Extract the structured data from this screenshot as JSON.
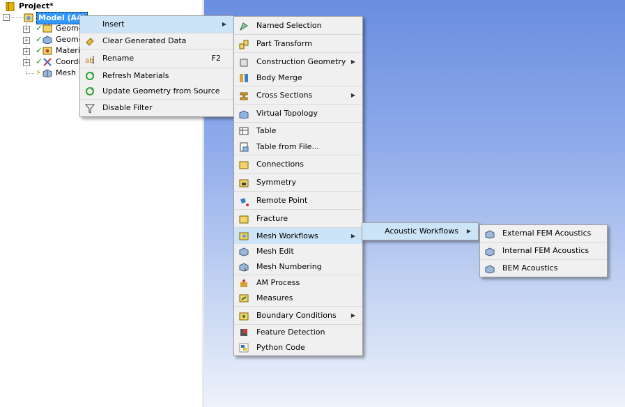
{
  "tree": {
    "project_label": "Project*",
    "model_label": "Model (A4)",
    "children": [
      {
        "label": "Geometry"
      },
      {
        "label": "Geometry"
      },
      {
        "label": "Materials"
      },
      {
        "label": "Coordinate Systems"
      },
      {
        "label": "Mesh"
      }
    ]
  },
  "context_menu": {
    "items": [
      {
        "label": "Insert",
        "icon": "none",
        "submenu": true
      },
      {
        "label": "Clear Generated Data",
        "icon": "eraser-icon"
      },
      {
        "label": "Rename",
        "icon": "rename-icon",
        "shortcut": "F2"
      },
      {
        "label": "Refresh Materials",
        "icon": "refresh-icon"
      },
      {
        "label": "Update Geometry from Source",
        "icon": "refresh-icon"
      },
      {
        "label": "Disable Filter",
        "icon": "filter-icon"
      }
    ]
  },
  "insert_menu": {
    "items": [
      {
        "label": "Named Selection"
      },
      {
        "label": "Part Transform"
      },
      {
        "label": "Construction Geometry"
      },
      {
        "label": "Body Merge"
      },
      {
        "label": "Cross Sections"
      },
      {
        "label": "Virtual Topology"
      },
      {
        "label": "Table"
      },
      {
        "label": "Table from File..."
      },
      {
        "label": "Connections"
      },
      {
        "label": "Symmetry"
      },
      {
        "label": "Remote Point"
      },
      {
        "label": "Fracture"
      },
      {
        "label": "Mesh Workflows"
      },
      {
        "label": "Mesh Edit"
      },
      {
        "label": "Mesh Numbering"
      },
      {
        "label": "AM Process"
      },
      {
        "label": "Measures"
      },
      {
        "label": "Boundary Conditions"
      },
      {
        "label": "Feature Detection"
      },
      {
        "label": "Python Code"
      }
    ]
  },
  "mesh_workflows_menu": {
    "items": [
      {
        "label": "Acoustic Workflows"
      }
    ]
  },
  "acoustic_menu": {
    "items": [
      {
        "label": "External FEM Acoustics"
      },
      {
        "label": "Internal FEM Acoustics"
      },
      {
        "label": "BEM Acoustics"
      }
    ]
  },
  "colors": {
    "highlight": "#cce4f7",
    "selection": "#3399ff",
    "check": "#1a9a1a"
  }
}
